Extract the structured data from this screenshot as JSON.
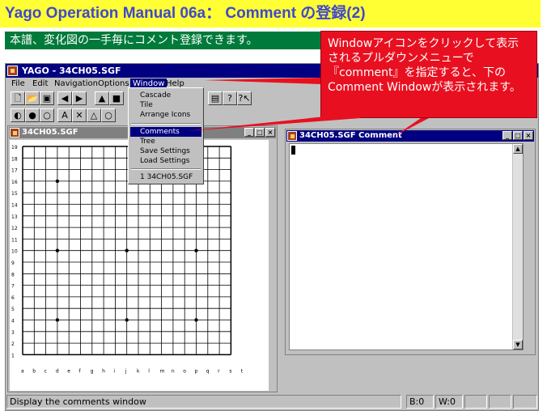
{
  "banner": {
    "title": "Yago Operation Manual 06a： Comment の登録(2)",
    "subtitle": "本譜、変化図の一手毎にコメント登録できます。"
  },
  "callout": {
    "text": "Windowアイコンをクリックして表示されるプルダウンメニューで『comment』を指定すると、下のComment Windowが表示されます。"
  },
  "app": {
    "title": "YAGO - 34CH05.SGF",
    "menu": [
      "File",
      "Edit",
      "Navigation",
      "Options",
      "Window",
      "Help"
    ],
    "window_menu": {
      "items": [
        "Cascade",
        "Tile",
        "Arrange Icons",
        "Comments",
        "Tree",
        "Save Settings",
        "Load Settings",
        "1 34CH05.SGF"
      ],
      "highlighted": "Comments"
    },
    "toolbar1": [
      "new-file-icon",
      "open-folder-icon",
      "save-icon",
      "prev-move-icon",
      "next-move-icon",
      "up-variation-icon",
      "stop-icon",
      "help-icon",
      "context-help-icon"
    ],
    "toolbar2": [
      "half-stone-icon",
      "black-stone-icon",
      "white-stone-icon",
      "A",
      "✕",
      "△",
      "○"
    ]
  },
  "board_window": {
    "title": "34CH05.SGF",
    "columns": [
      "a",
      "b",
      "c",
      "d",
      "e",
      "f",
      "g",
      "h",
      "i",
      "j",
      "k",
      "l",
      "m",
      "n",
      "o",
      "p",
      "q",
      "r",
      "s",
      "t"
    ],
    "rows": [
      "19",
      "18",
      "17",
      "16",
      "15",
      "14",
      "13",
      "12",
      "11",
      "10",
      "9",
      "8",
      "7",
      "6",
      "5",
      "4",
      "3",
      "2",
      "1"
    ],
    "star_points": [
      [
        4,
        16
      ],
      [
        4,
        10
      ],
      [
        4,
        4
      ],
      [
        10,
        10
      ],
      [
        10,
        4
      ],
      [
        16,
        16
      ],
      [
        16,
        10
      ],
      [
        16,
        4
      ]
    ]
  },
  "comment_window": {
    "title": "34CH05.SGF Comment"
  },
  "status": {
    "message": "Display the comments window",
    "black_captures": "B:0",
    "white_captures": "W:0"
  },
  "colors": {
    "banner_bg": "#ffff33",
    "banner_text": "#3f48cc",
    "subtitle_bg": "#007a3a",
    "callout_bg": "#e81020",
    "titlebar_active": "#000080",
    "titlebar_inactive": "#808080"
  }
}
